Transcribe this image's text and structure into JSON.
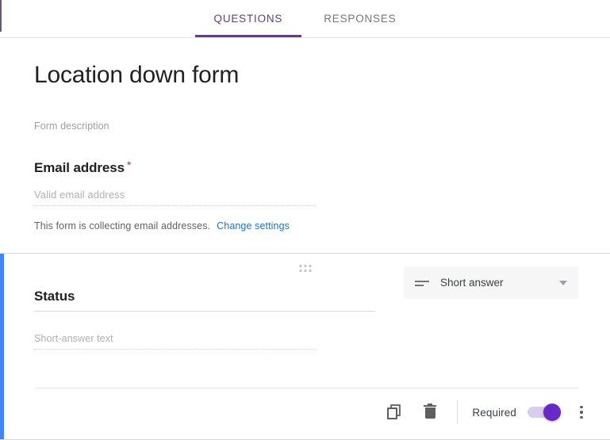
{
  "tabs": {
    "questions_label": "QUESTIONS",
    "responses_label": "RESPONSES",
    "active": "QUESTIONS",
    "accent_color": "#5d3f7e"
  },
  "header_card": {
    "form_title": "Location down form",
    "form_description_placeholder": "Form description",
    "email_question_label": "Email address",
    "email_required_marker": "*",
    "email_placeholder": "Valid email address",
    "collecting_note": "This form is collecting email addresses.",
    "change_settings_link": "Change settings",
    "link_color": "#2178b8",
    "required_marker_color": "#a8324a"
  },
  "question_card": {
    "drag_handle_icon": "drag-dots-icon",
    "title": "Status",
    "answer_placeholder": "Short-answer text",
    "selected_accent_color": "#4285f4",
    "type_select": {
      "icon": "short-answer-icon",
      "value": "Short answer",
      "chevron_icon": "chevron-down-icon"
    },
    "toolbar": {
      "duplicate_icon": "copy-icon",
      "delete_icon": "trash-icon",
      "required_label": "Required",
      "required_on": true,
      "toggle_color": "#6a29c4",
      "more_icon": "kebab-menu-icon"
    }
  }
}
